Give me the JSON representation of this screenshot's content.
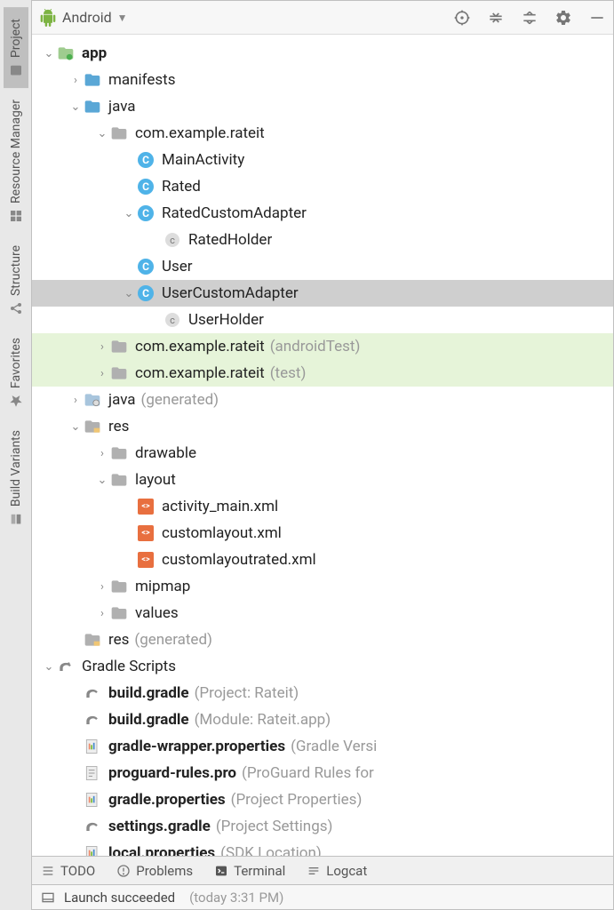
{
  "sidebar": {
    "tabs": [
      "Project",
      "Resource Manager",
      "Structure",
      "Favorites",
      "Build Variants"
    ]
  },
  "toolbar": {
    "selector": "Android"
  },
  "tree": {
    "app": "app",
    "manifests": "manifests",
    "java": "java",
    "pkg": "com.example.rateit",
    "mainActivity": "MainActivity",
    "rated": "Rated",
    "ratedCustomAdapter": "RatedCustomAdapter",
    "ratedHolder": "RatedHolder",
    "user": "User",
    "userCustomAdapter": "UserCustomAdapter",
    "userHolder": "UserHolder",
    "pkgAndroidTest": "com.example.rateit",
    "pkgAndroidTestSuffix": "(androidTest)",
    "pkgTest": "com.example.rateit",
    "pkgTestSuffix": "(test)",
    "javaGen": "java",
    "generated": "(generated)",
    "res": "res",
    "drawable": "drawable",
    "layout": "layout",
    "activityMain": "activity_main.xml",
    "customlayout": "customlayout.xml",
    "customlayoutrated": "customlayoutrated.xml",
    "mipmap": "mipmap",
    "values": "values",
    "resGen": "res",
    "gradleScripts": "Gradle Scripts",
    "buildGradle1": "build.gradle",
    "buildGradle1Suffix": "(Project: Rateit)",
    "buildGradle2": "build.gradle",
    "buildGradle2Suffix": "(Module: Rateit.app)",
    "gradleWrapper": "gradle-wrapper.properties",
    "gradleWrapperSuffix": "(Gradle Versi",
    "proguard": "proguard-rules.pro",
    "proguardSuffix": "(ProGuard Rules for",
    "gradleProps": "gradle.properties",
    "gradlePropsSuffix": "(Project Properties)",
    "settingsGradle": "settings.gradle",
    "settingsGradleSuffix": "(Project Settings)",
    "localProps": "local.properties",
    "localPropsSuffix": "(SDK Location)"
  },
  "bottom": {
    "todo": "TODO",
    "problems": "Problems",
    "terminal": "Terminal",
    "logcat": "Logcat"
  },
  "status": {
    "text": "Launch succeeded",
    "time": "(today 3:31 PM)"
  }
}
